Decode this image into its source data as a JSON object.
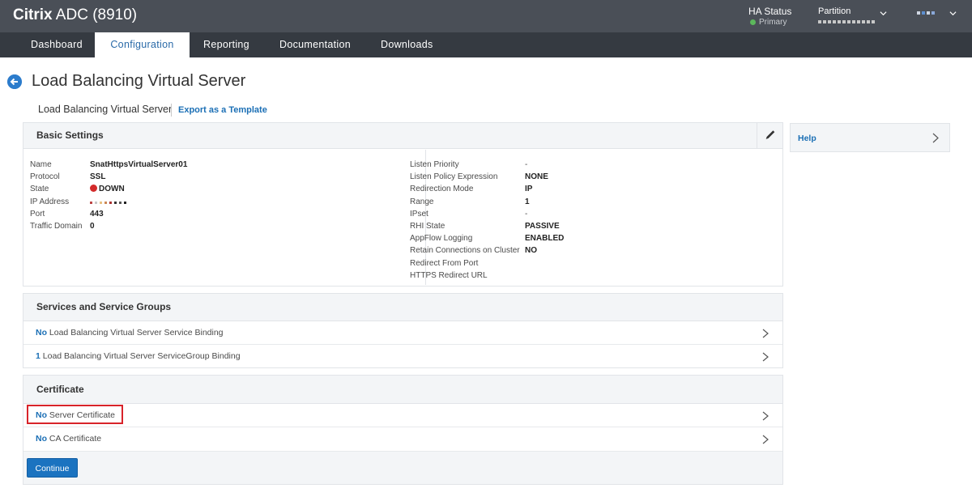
{
  "header": {
    "brand_bold": "Citrix",
    "brand_rest": " ADC (8910)",
    "ha_label": "HA Status",
    "ha_value": "Primary",
    "partition_label": "Partition"
  },
  "nav": {
    "tabs": [
      {
        "label": "Dashboard"
      },
      {
        "label": "Configuration"
      },
      {
        "label": "Reporting"
      },
      {
        "label": "Documentation"
      },
      {
        "label": "Downloads"
      }
    ],
    "active": "Configuration"
  },
  "page": {
    "title": "Load Balancing Virtual Server",
    "breadcrumb": "Load Balancing Virtual Server",
    "export_link": "Export as a Template"
  },
  "basic_settings": {
    "title": "Basic Settings",
    "left": [
      {
        "label": "Name",
        "value": "SnatHttpsVirtualServer01"
      },
      {
        "label": "Protocol",
        "value": "SSL"
      },
      {
        "label": "State",
        "value": "DOWN"
      },
      {
        "label": "IP Address",
        "value": ""
      },
      {
        "label": "Port",
        "value": "443"
      },
      {
        "label": "Traffic Domain",
        "value": "0"
      }
    ],
    "right": [
      {
        "label": "Listen Priority",
        "value": "-"
      },
      {
        "label": "Listen Policy Expression",
        "value": "NONE"
      },
      {
        "label": "Redirection Mode",
        "value": "IP"
      },
      {
        "label": "Range",
        "value": "1"
      },
      {
        "label": "IPset",
        "value": "-"
      },
      {
        "label": "RHI State",
        "value": "PASSIVE"
      },
      {
        "label": "AppFlow Logging",
        "value": "ENABLED"
      },
      {
        "label": "Retain Connections on Cluster",
        "value": "NO"
      },
      {
        "label": "Redirect From Port",
        "value": ""
      },
      {
        "label": "HTTPS Redirect URL",
        "value": ""
      }
    ]
  },
  "services": {
    "title": "Services and Service Groups",
    "rows": [
      {
        "count": "No",
        "label": " Load Balancing Virtual Server Service Binding"
      },
      {
        "count": "1",
        "label": " Load Balancing Virtual Server ServiceGroup Binding"
      }
    ]
  },
  "certificate": {
    "title": "Certificate",
    "rows": [
      {
        "count": "No",
        "label": " Server Certificate"
      },
      {
        "count": "No",
        "label": " CA Certificate"
      }
    ],
    "continue_label": "Continue"
  },
  "help": {
    "label": "Help"
  },
  "colors": {
    "accent": "#1b73c0",
    "state_down": "#d32b2b",
    "highlight": "#d8232a",
    "topbar": "#4a4f57"
  }
}
